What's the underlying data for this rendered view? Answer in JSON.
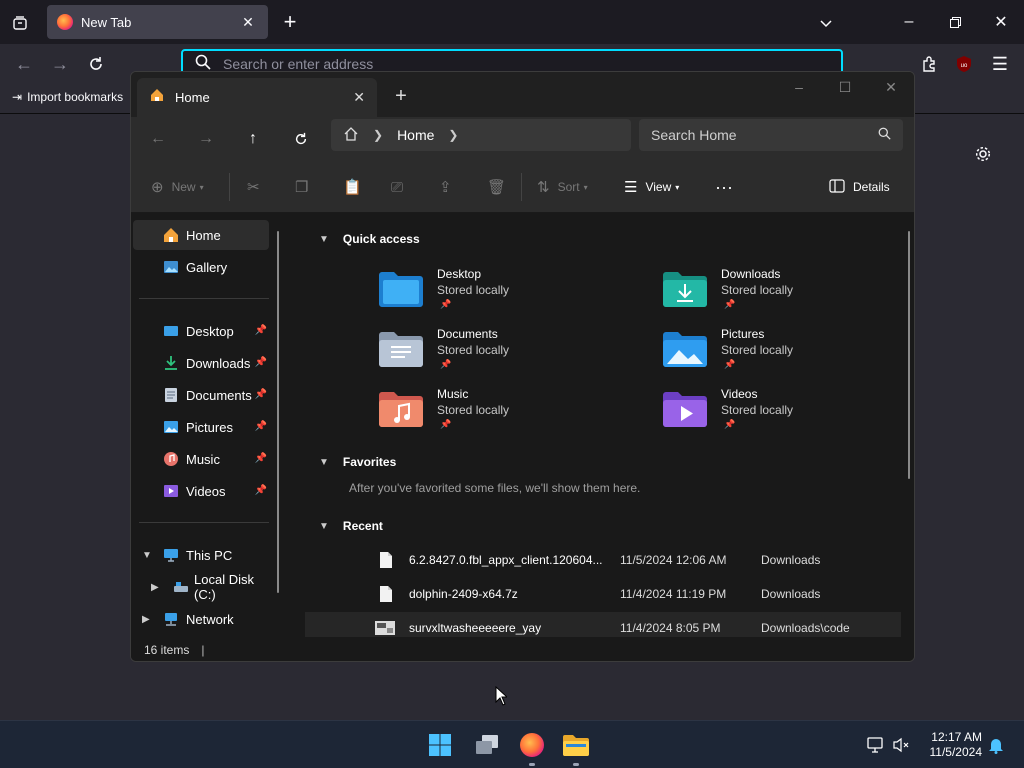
{
  "browser": {
    "tab_title": "New Tab",
    "url_placeholder": "Search or enter address",
    "import_bookmarks": "Import bookmarks",
    "extension_badge": "uo"
  },
  "explorer": {
    "tab_title": "Home",
    "breadcrumb": [
      "Home"
    ],
    "search_placeholder": "Search Home",
    "toolbar": {
      "new_label": "New",
      "sort_label": "Sort",
      "view_label": "View",
      "details_label": "Details"
    },
    "sidebar": {
      "top": [
        {
          "label": "Home",
          "icon": "home-icon",
          "selected": true
        },
        {
          "label": "Gallery",
          "icon": "gallery-icon"
        }
      ],
      "pinned": [
        {
          "label": "Desktop",
          "icon": "desktop-icon"
        },
        {
          "label": "Downloads",
          "icon": "downloads-icon"
        },
        {
          "label": "Documents",
          "icon": "documents-icon"
        },
        {
          "label": "Pictures",
          "icon": "pictures-icon"
        },
        {
          "label": "Music",
          "icon": "music-icon"
        },
        {
          "label": "Videos",
          "icon": "videos-icon"
        }
      ],
      "this_pc": "This PC",
      "local_disk": "Local Disk (C:)",
      "network": "Network"
    },
    "quick_access": {
      "heading": "Quick access",
      "items": [
        {
          "name": "Desktop",
          "sub": "Stored locally"
        },
        {
          "name": "Downloads",
          "sub": "Stored locally"
        },
        {
          "name": "Documents",
          "sub": "Stored locally"
        },
        {
          "name": "Pictures",
          "sub": "Stored locally"
        },
        {
          "name": "Music",
          "sub": "Stored locally"
        },
        {
          "name": "Videos",
          "sub": "Stored locally"
        }
      ]
    },
    "favorites": {
      "heading": "Favorites",
      "empty_text": "After you've favorited some files, we'll show them here."
    },
    "recent": {
      "heading": "Recent",
      "rows": [
        {
          "name": "6.2.8427.0.fbl_appx_client.120604...",
          "date": "11/5/2024 12:06 AM",
          "location": "Downloads"
        },
        {
          "name": "dolphin-2409-x64.7z",
          "date": "11/4/2024 11:19 PM",
          "location": "Downloads"
        },
        {
          "name": "survxltwasheeeeere_yay",
          "date": "11/4/2024 8:05 PM",
          "location": "Downloads\\code"
        }
      ]
    },
    "status": {
      "items": "16 items"
    }
  },
  "taskbar": {
    "time": "12:17 AM",
    "date": "11/5/2024"
  },
  "colors": {
    "accent": "#00ddff",
    "folder_blue": "#2f8bd6",
    "folder_teal": "#1fa89a"
  }
}
